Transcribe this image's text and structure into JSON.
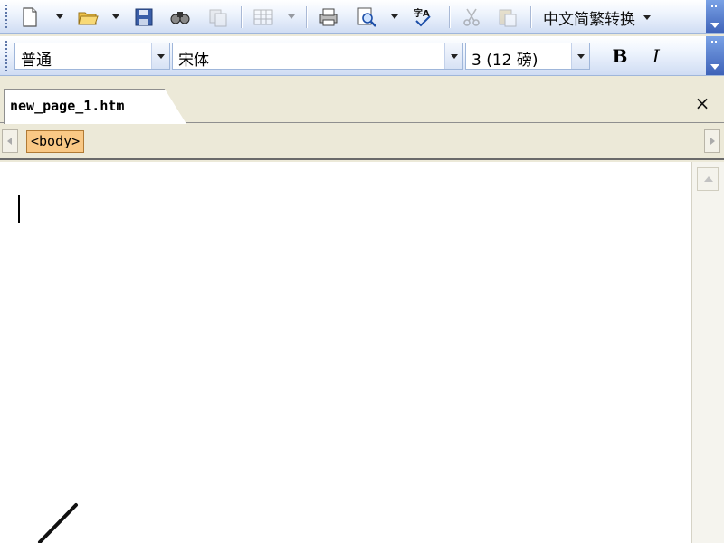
{
  "toolbar_standard": {
    "icons": [
      "new-page-icon",
      "open-folder-icon",
      "save-icon",
      "find-icon",
      "copy-page-icon",
      "table-icon",
      "print-icon",
      "print-preview-icon",
      "spelling-icon",
      "cut-icon",
      "paste-icon"
    ],
    "convert_label": "中文简繁转换"
  },
  "toolbar_format": {
    "style_value": "普通",
    "font_value": "宋体",
    "size_value": "3 (12 磅)",
    "bold_label": "B",
    "italic_label": "I"
  },
  "tabs": [
    {
      "label": "new_page_1.htm",
      "active": true
    }
  ],
  "tab_close_label": "×",
  "tag_selector": {
    "tags": [
      "<body>"
    ]
  },
  "colors": {
    "toolbar_blue": "#3e62b8",
    "tag_highlight": "#f9c885",
    "chrome": "#ece9d8"
  }
}
